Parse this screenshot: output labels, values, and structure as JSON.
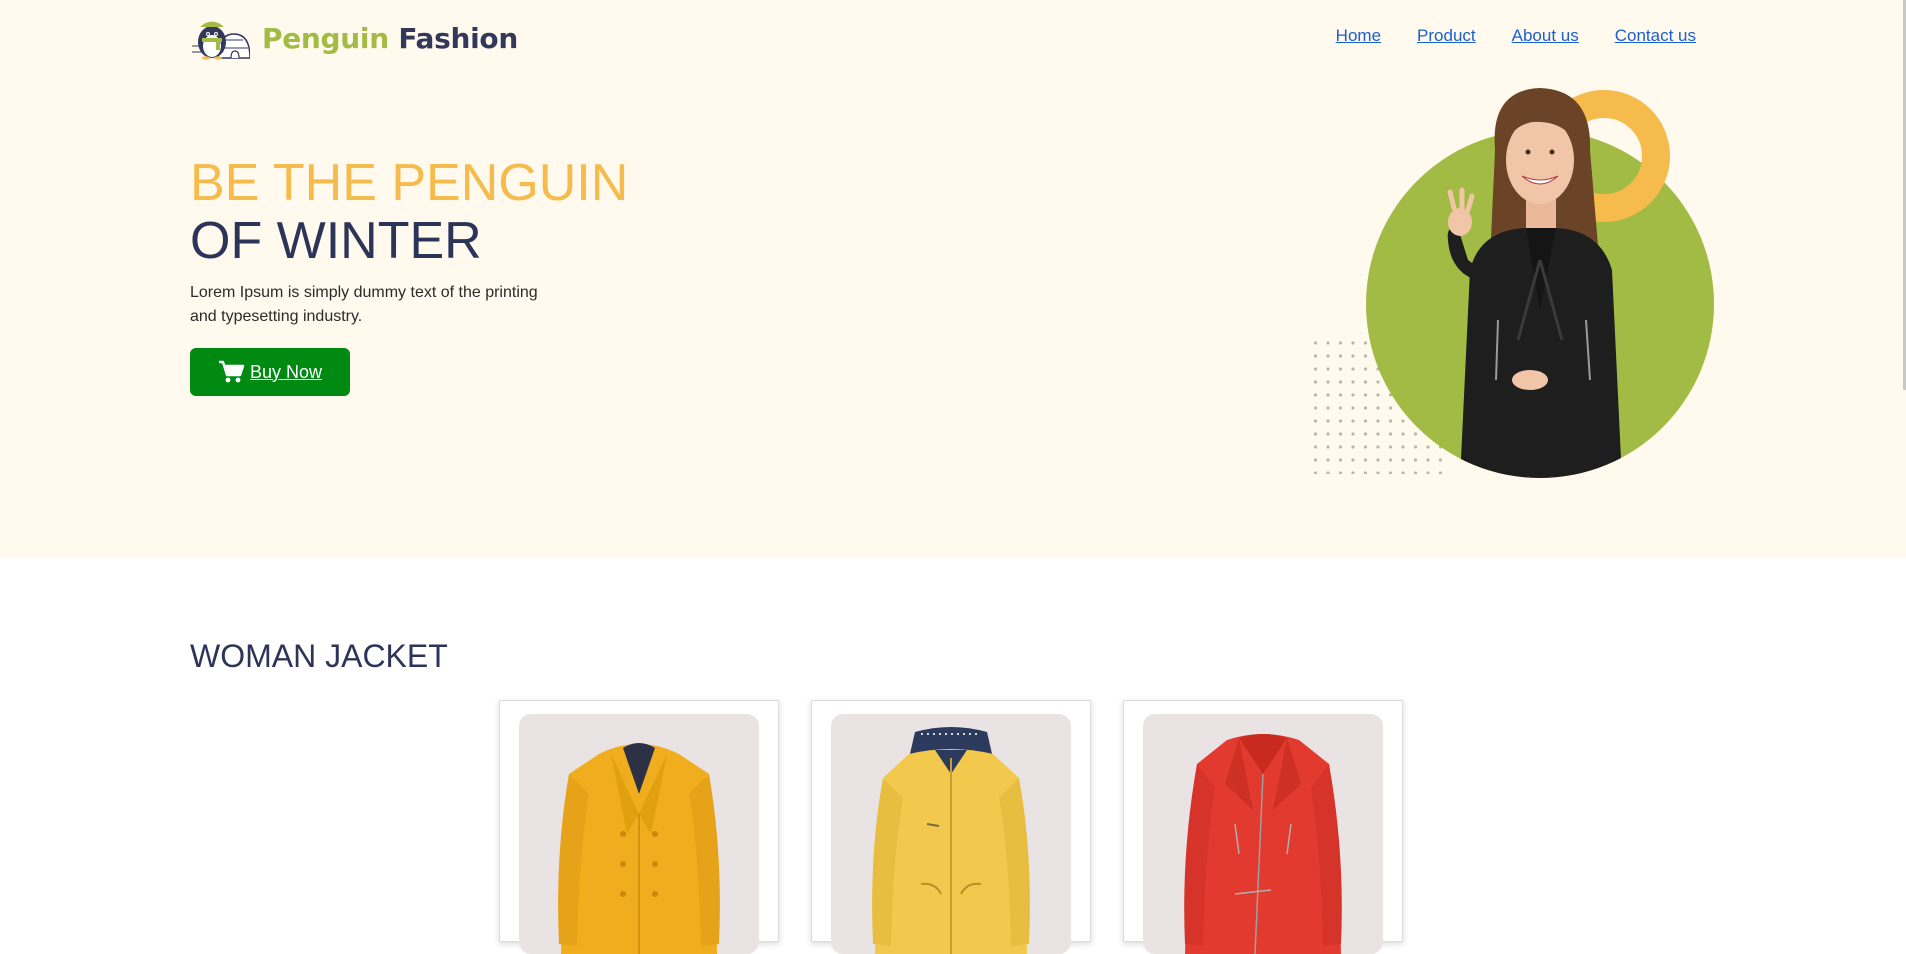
{
  "brand": {
    "name_part1": "Penguin",
    "name_part2": "Fashion"
  },
  "nav": {
    "items": [
      {
        "label": "Home"
      },
      {
        "label": "Product"
      },
      {
        "label": "About us"
      },
      {
        "label": "Contact us"
      }
    ]
  },
  "hero": {
    "headline_line1": "BE THE PENGUIN",
    "headline_line2": "OF WINTER",
    "description": "Lorem Ipsum is simply dummy text of the printing and typesetting industry.",
    "button_label": "Buy Now",
    "button_icon": "cart-icon"
  },
  "section": {
    "title": "WOMAN JACKET"
  },
  "products": [
    {
      "image": "yellow-pea-coat"
    },
    {
      "image": "yellow-hooded-jacket"
    },
    {
      "image": "red-leather-jacket"
    }
  ],
  "colors": {
    "hero_bg": "#fffaed",
    "accent_orange": "#f5bb4d",
    "accent_green": "#a2bb44",
    "navy": "#2d3459",
    "button_green": "#008a12",
    "link": "#1a5fd0"
  }
}
